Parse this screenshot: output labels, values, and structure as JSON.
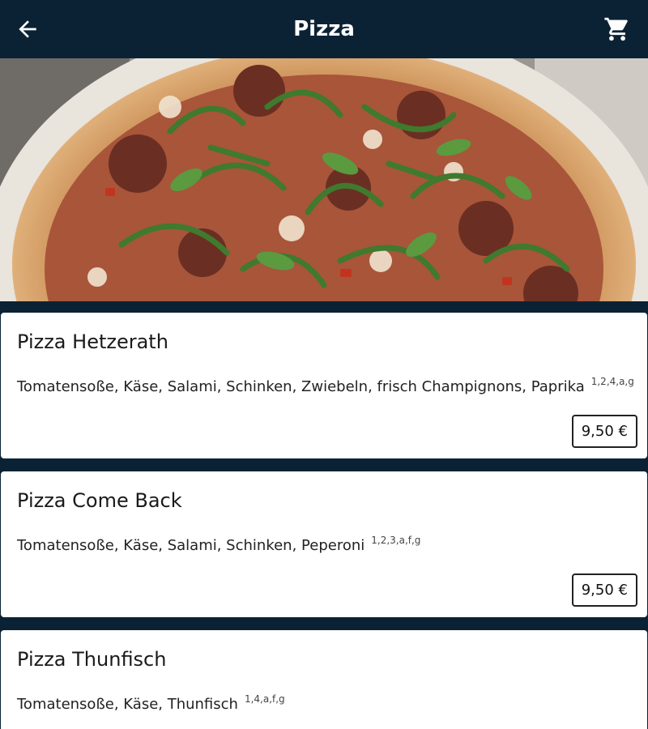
{
  "header": {
    "title": "Pizza",
    "back_icon": "arrow-left-icon",
    "cart_icon": "shopping-cart-icon"
  },
  "hero": {
    "image": "pizza-photo"
  },
  "items": [
    {
      "name": "Pizza Hetzerath",
      "description": "Tomatensoße, Käse, Salami, Schinken, Zwiebeln, frisch Champignons, Paprika",
      "allergens": "1,2,4,a,g",
      "price": "9,50 €"
    },
    {
      "name": "Pizza Come Back",
      "description": "Tomatensoße, Käse, Salami, Schinken, Peperoni",
      "allergens": "1,2,3,a,f,g",
      "price": "9,50 €"
    },
    {
      "name": "Pizza Thunfisch",
      "description": "Tomatensoße, Käse, Thunfisch",
      "allergens": "1,4,a,f,g"
    }
  ],
  "colors": {
    "header_bg": "#0b2235",
    "card_bg": "#ffffff",
    "text": "#1a1a1a"
  }
}
